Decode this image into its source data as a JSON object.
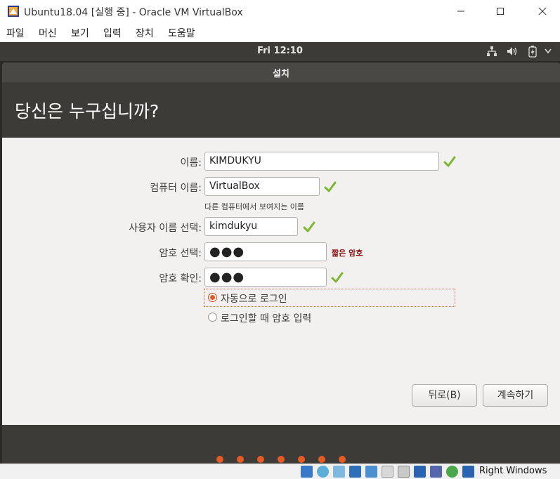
{
  "window": {
    "title": "Ubuntu18.04 [실행 중] - Oracle VM VirtualBox",
    "menu": [
      "파일",
      "머신",
      "보기",
      "입력",
      "장치",
      "도움말"
    ]
  },
  "guest": {
    "clock": "Fri 12:10",
    "tray": [
      "network-icon",
      "volume-icon",
      "battery-icon",
      "power-menu-icon"
    ]
  },
  "installer": {
    "window_title": "설치",
    "heading": "당신은 누구십니까?",
    "fields": {
      "name": {
        "label": "이름:",
        "value": "KIMDUKYU"
      },
      "computer": {
        "label": "컴퓨터 이름:",
        "value": "VirtualBox",
        "hint": "다른 컴퓨터에서 보여지는 이름"
      },
      "username": {
        "label": "사용자 이름 선택:",
        "value": "kimdukyu"
      },
      "password": {
        "label": "암호 선택:",
        "value": "●●●",
        "warning": "짧은 암호"
      },
      "confirm": {
        "label": "암호 확인:",
        "value": "●●●"
      }
    },
    "login_options": [
      {
        "label": "자동으로 로그인",
        "selected": true
      },
      {
        "label": "로그인할 때 암호 입력",
        "selected": false
      }
    ],
    "buttons": {
      "back": "뒤로(B)",
      "continue": "계속하기"
    },
    "progress": {
      "total_steps": 7
    }
  },
  "statusbar": {
    "host_key": "Right Windows"
  },
  "colors": {
    "accent": "#e65a24",
    "check": "#7cb82f",
    "warning": "#8c1010"
  }
}
